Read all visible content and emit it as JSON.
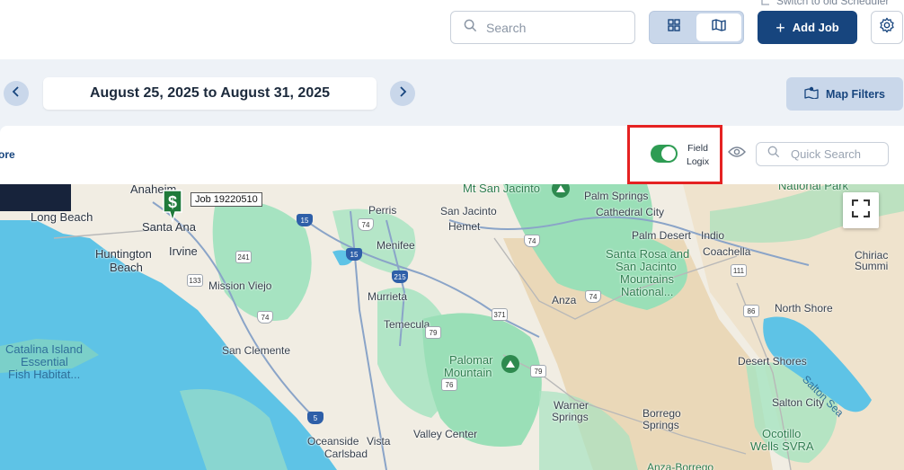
{
  "header": {
    "switch_old": "Switch to old Scheduler",
    "search_placeholder": "Search",
    "add_job_label": "Add Job"
  },
  "date_nav": {
    "range": "August 25, 2025 to August 31, 2025"
  },
  "map_filters_label": "Map Filters",
  "panel": {
    "more_link": "ore",
    "toggle_label_line1": "Field",
    "toggle_label_line2": "Logix",
    "toggle_on": true,
    "quick_search_placeholder": "Quick Search"
  },
  "map": {
    "pin_label": "Job 19220510",
    "places": {
      "anaheim": "Anaheim",
      "long_beach": "Long Beach",
      "santa_ana": "Santa Ana",
      "huntington": "Huntington",
      "beach": "Beach",
      "irvine": "Irvine",
      "mission_viejo": "Mission Viejo",
      "catalina1": "Catalina Island",
      "catalina2": "Essential",
      "catalina3": "Fish Habitat...",
      "san_clemente": "San Clemente",
      "oceanside": "Oceanside",
      "vista": "Vista",
      "carlsbad": "Carlsbad",
      "perris": "Perris",
      "menifee": "Menifee",
      "murrieta": "Murrieta",
      "temecula": "Temecula",
      "san_jacinto": "San Jacinto",
      "hemet": "Hemet",
      "mt_san_jacinto": "Mt San Jacinto",
      "palm_springs": "Palm Springs",
      "cathedral_city": "Cathedral City",
      "palm_desert": "Palm Desert",
      "indio": "Indio",
      "coachella": "Coachella",
      "srsj1": "Santa Rosa and",
      "srsj2": "San Jacinto",
      "srsj3": "Mountains",
      "srsj4": "National...",
      "anza": "Anza",
      "palomar1": "Palomar",
      "palomar2": "Mountain",
      "warner1": "Warner",
      "warner2": "Springs",
      "valley_center": "Valley Center",
      "borrego1": "Borrego",
      "borrego2": "Springs",
      "north_shore": "North Shore",
      "desert_shores": "Desert Shores",
      "salton_sea": "Salton Sea",
      "salton_city": "Salton City",
      "ocotillo1": "Ocotillo",
      "ocotillo2": "Wells SVRA",
      "national_park": "National Park",
      "chiriaco1": "Chiriac",
      "chiriaco2": "Summi",
      "anza_borrego": "Anza-Borrego"
    },
    "highways": {
      "h15a": "15",
      "h15b": "15",
      "h215": "215",
      "h74a": "74",
      "h74b": "74",
      "h74c": "74",
      "h74d": "74",
      "h241": "241",
      "h133": "133",
      "h371": "371",
      "h79a": "79",
      "h79b": "79",
      "h76": "76",
      "h5": "5",
      "h111": "111",
      "h86": "86"
    }
  }
}
